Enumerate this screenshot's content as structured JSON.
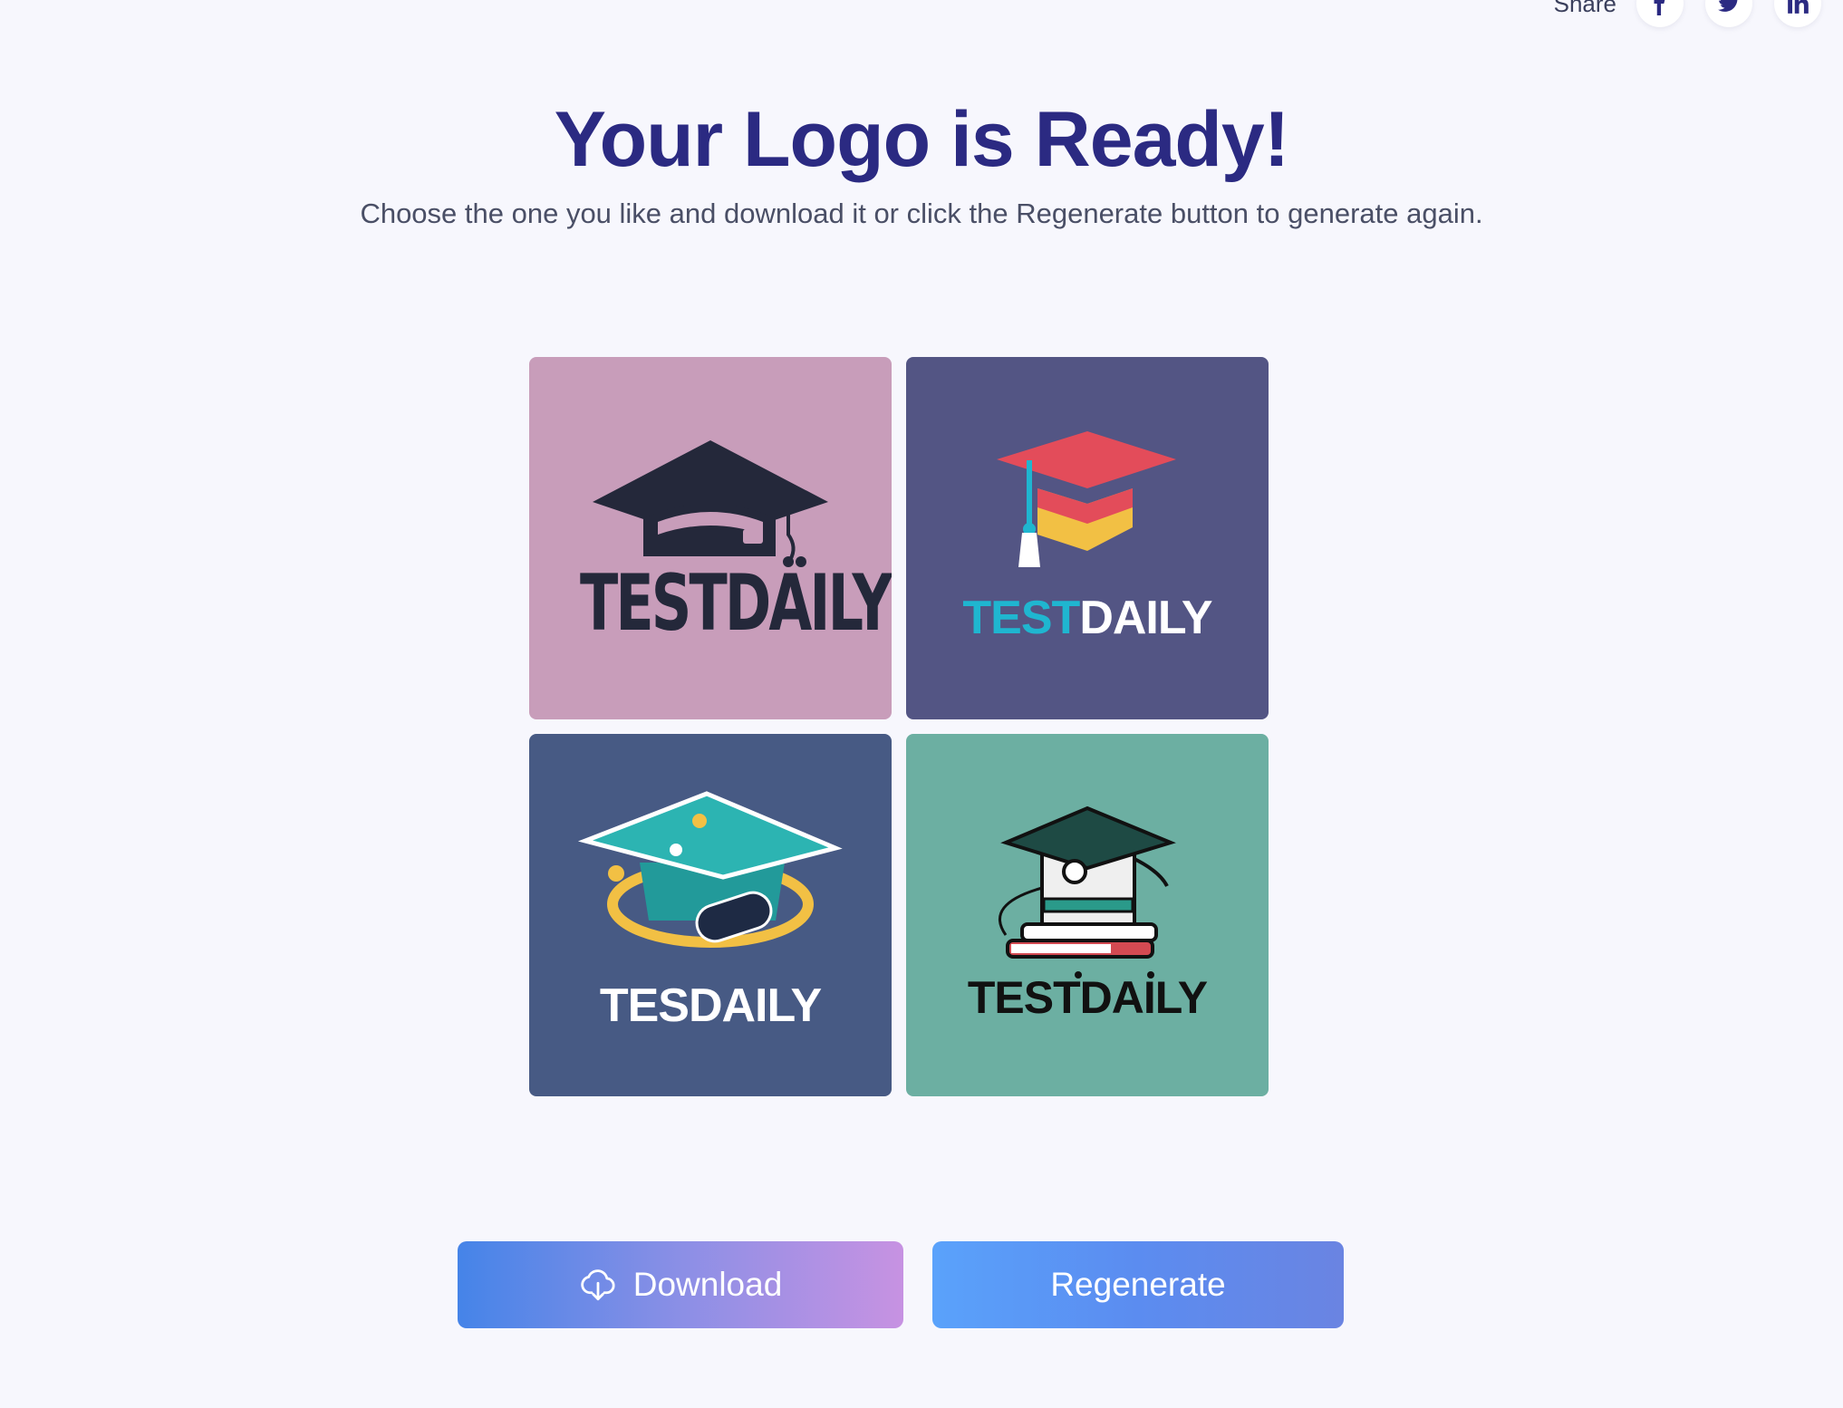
{
  "share": {
    "label": "Share",
    "networks": [
      "facebook-icon",
      "twitter-icon",
      "linkedin-icon"
    ],
    "icon_color": "#2b2a82"
  },
  "header": {
    "title": "Your Logo is Ready!",
    "subtitle": "Choose the one you like and download it or click the Regenerate button to generate again."
  },
  "logos": [
    {
      "wordmark": "TESTDAILY",
      "background": "#c89dba"
    },
    {
      "wordmark_part_a": "TEST",
      "wordmark_part_b": "DAILY",
      "background": "#535584"
    },
    {
      "wordmark": "TESDAILY",
      "background": "#475a84"
    },
    {
      "wordmark": "TESTDAILY",
      "background": "#6cafa2"
    }
  ],
  "actions": {
    "download_label": "Download",
    "download_icon": "cloud-download-icon",
    "regenerate_label": "Regenerate"
  },
  "colors": {
    "title": "#2b2a82",
    "page_background": "#f7f7fd"
  }
}
